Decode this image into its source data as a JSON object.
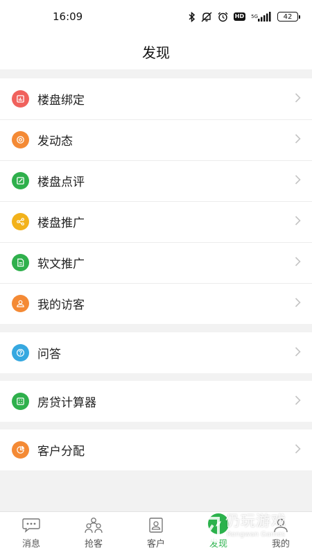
{
  "status_bar": {
    "time": "16:09",
    "net": "5G",
    "hd": "HD",
    "battery": "42",
    "icons": [
      "bluetooth-icon",
      "mute-icon",
      "alarm-icon",
      "hd-icon",
      "signal-icon",
      "battery-icon"
    ]
  },
  "header": {
    "title": "发现"
  },
  "groups": [
    {
      "items": [
        {
          "label": "楼盘绑定",
          "color": "#f0625d",
          "icon": "building-icon"
        },
        {
          "label": "发动态",
          "color": "#f48a35",
          "icon": "target-icon"
        },
        {
          "label": "楼盘点评",
          "color": "#2fb04c",
          "icon": "edit-icon"
        },
        {
          "label": "楼盘推广",
          "color": "#f2b21b",
          "icon": "share-icon"
        },
        {
          "label": "软文推广",
          "color": "#2fb04c",
          "icon": "document-icon"
        },
        {
          "label": "我的访客",
          "color": "#f48a35",
          "icon": "visitor-icon"
        }
      ]
    },
    {
      "items": [
        {
          "label": "问答",
          "color": "#36a8e0",
          "icon": "question-icon"
        }
      ]
    },
    {
      "items": [
        {
          "label": "房贷计算器",
          "color": "#2fb04c",
          "icon": "calculator-icon"
        }
      ]
    },
    {
      "items": [
        {
          "label": "客户分配",
          "color": "#f48a35",
          "icon": "pie-icon"
        }
      ]
    }
  ],
  "tabbar": {
    "tabs": [
      {
        "label": "消息",
        "icon": "message-icon",
        "active": false
      },
      {
        "label": "抢客",
        "icon": "people-icon",
        "active": false
      },
      {
        "label": "客户",
        "icon": "contacts-icon",
        "active": false
      },
      {
        "label": "发现",
        "icon": "discover-icon",
        "active": true
      },
      {
        "label": "我的",
        "icon": "profile-icon",
        "active": false
      }
    ],
    "active_color": "#2bb24c"
  },
  "watermark": {
    "text": "仍玩游戏",
    "sub": "Rengwan Games"
  }
}
